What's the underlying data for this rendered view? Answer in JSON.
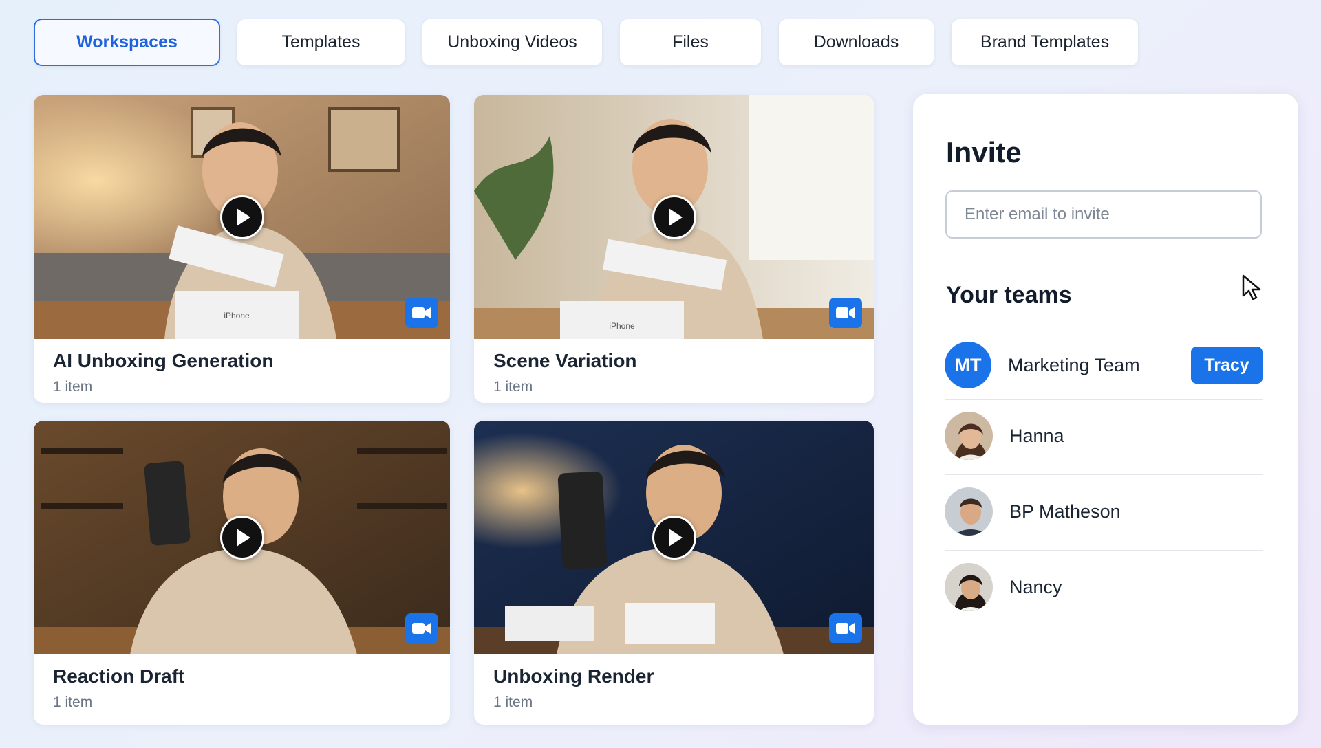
{
  "tabs": [
    {
      "label": "Workspaces",
      "active": true
    },
    {
      "label": "Templates",
      "active": false
    },
    {
      "label": "Unboxing Videos",
      "active": false
    },
    {
      "label": "Files",
      "active": false
    },
    {
      "label": "Downloads",
      "active": false
    },
    {
      "label": "Brand Templates",
      "active": false
    }
  ],
  "workspaces": [
    {
      "title": "AI Unboxing Generation",
      "count": "1 item",
      "box_label": "iPhone",
      "icon": "video-camera-icon"
    },
    {
      "title": "Scene Variation",
      "count": "1 item",
      "box_label": "iPhone",
      "icon": "video-camera-icon"
    },
    {
      "title": "Reaction Draft",
      "count": "1 item",
      "icon": "video-camera-icon"
    },
    {
      "title": "Unboxing Render",
      "count": "1 item",
      "icon": "video-camera-icon"
    }
  ],
  "invite": {
    "title": "Invite",
    "email_placeholder": "Enter email to invite",
    "email_value": ""
  },
  "teams": {
    "title": "Your teams",
    "team": {
      "initials": "MT",
      "name": "Marketing Team",
      "owner_button": "Tracy"
    },
    "members": [
      {
        "name": "Hanna"
      },
      {
        "name": "BP Matheson"
      },
      {
        "name": "Nancy"
      }
    ]
  },
  "colors": {
    "accent": "#1a73e8",
    "active_tab_border": "#2f6ce0",
    "active_tab_text": "#1f62de"
  }
}
